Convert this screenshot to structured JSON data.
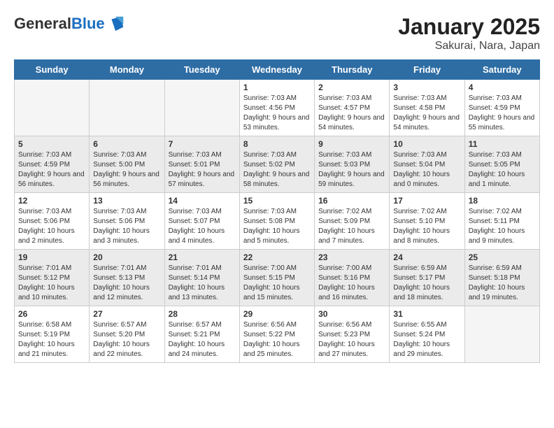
{
  "header": {
    "logo": {
      "general": "General",
      "blue": "Blue"
    },
    "title": "January 2025",
    "subtitle": "Sakurai, Nara, Japan"
  },
  "calendar": {
    "days_of_week": [
      "Sunday",
      "Monday",
      "Tuesday",
      "Wednesday",
      "Thursday",
      "Friday",
      "Saturday"
    ],
    "weeks": [
      {
        "shaded": false,
        "days": [
          {
            "num": "",
            "empty": true
          },
          {
            "num": "",
            "empty": true
          },
          {
            "num": "",
            "empty": true
          },
          {
            "num": "1",
            "sunrise": "7:03 AM",
            "sunset": "4:56 PM",
            "daylight": "9 hours and 53 minutes."
          },
          {
            "num": "2",
            "sunrise": "7:03 AM",
            "sunset": "4:57 PM",
            "daylight": "9 hours and 54 minutes."
          },
          {
            "num": "3",
            "sunrise": "7:03 AM",
            "sunset": "4:58 PM",
            "daylight": "9 hours and 54 minutes."
          },
          {
            "num": "4",
            "sunrise": "7:03 AM",
            "sunset": "4:59 PM",
            "daylight": "9 hours and 55 minutes."
          }
        ]
      },
      {
        "shaded": true,
        "days": [
          {
            "num": "5",
            "sunrise": "7:03 AM",
            "sunset": "4:59 PM",
            "daylight": "9 hours and 56 minutes."
          },
          {
            "num": "6",
            "sunrise": "7:03 AM",
            "sunset": "5:00 PM",
            "daylight": "9 hours and 56 minutes."
          },
          {
            "num": "7",
            "sunrise": "7:03 AM",
            "sunset": "5:01 PM",
            "daylight": "9 hours and 57 minutes."
          },
          {
            "num": "8",
            "sunrise": "7:03 AM",
            "sunset": "5:02 PM",
            "daylight": "9 hours and 58 minutes."
          },
          {
            "num": "9",
            "sunrise": "7:03 AM",
            "sunset": "5:03 PM",
            "daylight": "9 hours and 59 minutes."
          },
          {
            "num": "10",
            "sunrise": "7:03 AM",
            "sunset": "5:04 PM",
            "daylight": "10 hours and 0 minutes."
          },
          {
            "num": "11",
            "sunrise": "7:03 AM",
            "sunset": "5:05 PM",
            "daylight": "10 hours and 1 minute."
          }
        ]
      },
      {
        "shaded": false,
        "days": [
          {
            "num": "12",
            "sunrise": "7:03 AM",
            "sunset": "5:06 PM",
            "daylight": "10 hours and 2 minutes."
          },
          {
            "num": "13",
            "sunrise": "7:03 AM",
            "sunset": "5:06 PM",
            "daylight": "10 hours and 3 minutes."
          },
          {
            "num": "14",
            "sunrise": "7:03 AM",
            "sunset": "5:07 PM",
            "daylight": "10 hours and 4 minutes."
          },
          {
            "num": "15",
            "sunrise": "7:03 AM",
            "sunset": "5:08 PM",
            "daylight": "10 hours and 5 minutes."
          },
          {
            "num": "16",
            "sunrise": "7:02 AM",
            "sunset": "5:09 PM",
            "daylight": "10 hours and 7 minutes."
          },
          {
            "num": "17",
            "sunrise": "7:02 AM",
            "sunset": "5:10 PM",
            "daylight": "10 hours and 8 minutes."
          },
          {
            "num": "18",
            "sunrise": "7:02 AM",
            "sunset": "5:11 PM",
            "daylight": "10 hours and 9 minutes."
          }
        ]
      },
      {
        "shaded": true,
        "days": [
          {
            "num": "19",
            "sunrise": "7:01 AM",
            "sunset": "5:12 PM",
            "daylight": "10 hours and 10 minutes."
          },
          {
            "num": "20",
            "sunrise": "7:01 AM",
            "sunset": "5:13 PM",
            "daylight": "10 hours and 12 minutes."
          },
          {
            "num": "21",
            "sunrise": "7:01 AM",
            "sunset": "5:14 PM",
            "daylight": "10 hours and 13 minutes."
          },
          {
            "num": "22",
            "sunrise": "7:00 AM",
            "sunset": "5:15 PM",
            "daylight": "10 hours and 15 minutes."
          },
          {
            "num": "23",
            "sunrise": "7:00 AM",
            "sunset": "5:16 PM",
            "daylight": "10 hours and 16 minutes."
          },
          {
            "num": "24",
            "sunrise": "6:59 AM",
            "sunset": "5:17 PM",
            "daylight": "10 hours and 18 minutes."
          },
          {
            "num": "25",
            "sunrise": "6:59 AM",
            "sunset": "5:18 PM",
            "daylight": "10 hours and 19 minutes."
          }
        ]
      },
      {
        "shaded": false,
        "days": [
          {
            "num": "26",
            "sunrise": "6:58 AM",
            "sunset": "5:19 PM",
            "daylight": "10 hours and 21 minutes."
          },
          {
            "num": "27",
            "sunrise": "6:57 AM",
            "sunset": "5:20 PM",
            "daylight": "10 hours and 22 minutes."
          },
          {
            "num": "28",
            "sunrise": "6:57 AM",
            "sunset": "5:21 PM",
            "daylight": "10 hours and 24 minutes."
          },
          {
            "num": "29",
            "sunrise": "6:56 AM",
            "sunset": "5:22 PM",
            "daylight": "10 hours and 25 minutes."
          },
          {
            "num": "30",
            "sunrise": "6:56 AM",
            "sunset": "5:23 PM",
            "daylight": "10 hours and 27 minutes."
          },
          {
            "num": "31",
            "sunrise": "6:55 AM",
            "sunset": "5:24 PM",
            "daylight": "10 hours and 29 minutes."
          },
          {
            "num": "",
            "empty": true
          }
        ]
      }
    ]
  }
}
